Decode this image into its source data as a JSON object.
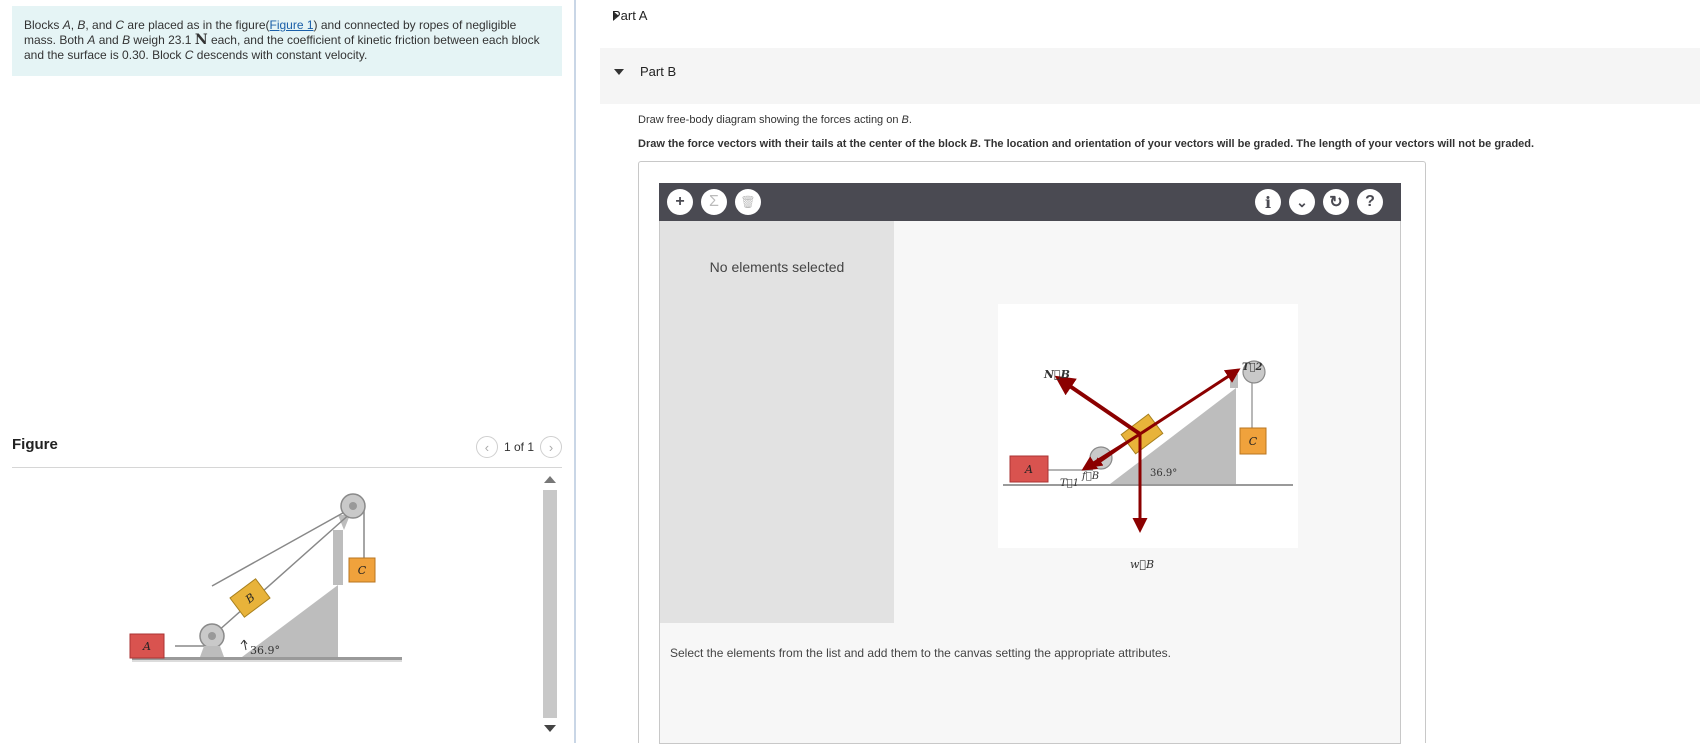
{
  "problem": {
    "line1_a": "Blocks ",
    "A": "A",
    "sep1": ", ",
    "B": "B",
    "sep2": ", and ",
    "C": "C",
    "line1_b": " are placed as in the figure(",
    "figure_link": "Figure 1",
    "line1_c": ") and connected by ropes of negligible mass. Both ",
    "line1_d": " and ",
    "line1_e": " weigh 23.1 ",
    "unit_N": "N",
    "line1_f": " each, and the coefficient of kinetic friction between each block and the surface is 0.30. Block ",
    "line1_g": "  descends with constant velocity."
  },
  "figure": {
    "title": "Figure",
    "pager_text": "1 of 1",
    "prev_icon": "chevron-left-icon",
    "next_icon": "chevron-right-icon",
    "angle_label": "36.9°",
    "block_labels": [
      "A",
      "B",
      "C"
    ]
  },
  "partA": {
    "label": "Part A"
  },
  "partB": {
    "label": "Part B",
    "instruction1_a": "Draw free-body diagram showing the forces acting on ",
    "instruction1_b": "B",
    "instruction1_c": ".",
    "instruction2_a": "Draw the force vectors with their tails at the center of the block ",
    "instruction2_b": "B",
    "instruction2_c": ". The location and orientation of your vectors will be graded. The length of your vectors will not be graded."
  },
  "tool": {
    "buttons_left": [
      {
        "icon": "plus-icon",
        "glyph": "+"
      },
      {
        "icon": "sigma-icon",
        "glyph": "Σ"
      },
      {
        "icon": "trash-icon",
        "glyph": "🗑"
      }
    ],
    "buttons_right": [
      {
        "icon": "info-icon",
        "glyph": "i"
      },
      {
        "icon": "chevron-down-icon",
        "glyph": "⌄"
      },
      {
        "icon": "reset-icon",
        "glyph": "↻"
      },
      {
        "icon": "help-icon",
        "glyph": "?"
      }
    ],
    "no_selection": "No elements selected",
    "select_note": "Select the elements from the list and add them to the canvas setting the appropriate attributes.",
    "vector_labels": [
      "N⃗B",
      "T⃗2",
      "T⃗1",
      "f⃗B",
      "w⃗B"
    ],
    "canvas_angle_label": "36.9°"
  },
  "colors": {
    "block_A": "#d9534f",
    "block_B": "#e8b33a",
    "block_C": "#f0a23c",
    "vector": "#8b0000",
    "toolbar": "#4a4a52"
  }
}
